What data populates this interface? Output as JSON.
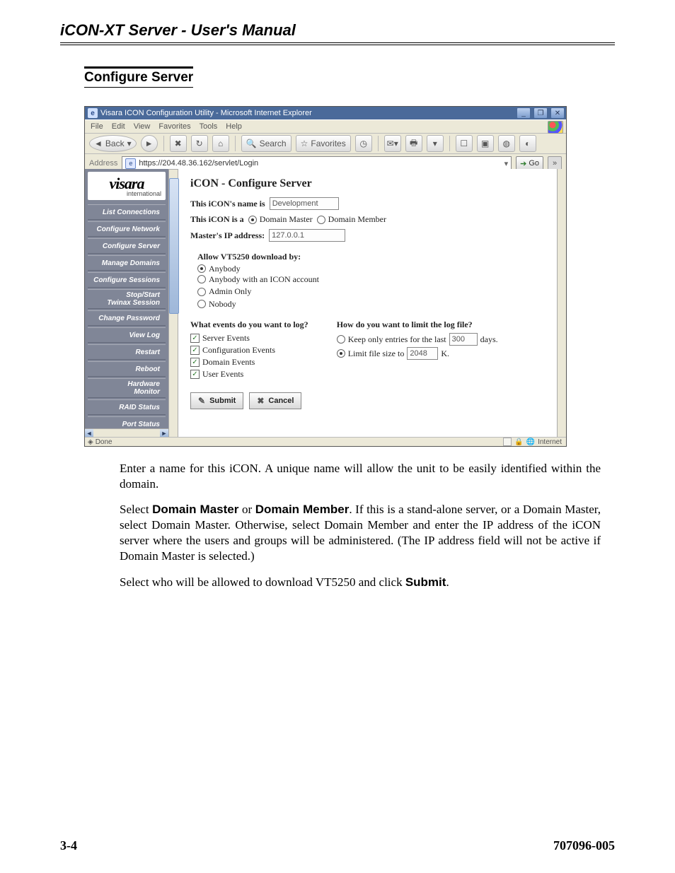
{
  "doc": {
    "header_title": "iCON-XT Server - User's Manual",
    "section_title": "Configure Server",
    "footer_left": "3-4",
    "footer_right": "707096-005"
  },
  "titlebar": {
    "app_icon": "e",
    "title": "Visara ICON Configuration Utility - Microsoft Internet Explorer",
    "min": "_",
    "restore": "❐",
    "close": "✕"
  },
  "menus": {
    "file": "File",
    "edit": "Edit",
    "view": "View",
    "favorites": "Favorites",
    "tools": "Tools",
    "help": "Help"
  },
  "toolbar": {
    "back_label": "Back",
    "search_label": "Search",
    "favorites_label": "Favorites"
  },
  "address_bar": {
    "label": "Address",
    "url": "https://204.48.36.162/servlet/Login",
    "go": "Go"
  },
  "sidebar": {
    "logo_main": "visara",
    "logo_sub": "international",
    "items": [
      "List Connections",
      "Configure Network",
      "Configure Server",
      "Manage Domains",
      "Configure Sessions",
      "Stop/Start\nTwinax Session",
      "Change Password",
      "View Log",
      "Restart",
      "Reboot",
      "Hardware\nMonitor",
      "RAID Status",
      "Port Status"
    ]
  },
  "form": {
    "heading": "iCON - Configure Server",
    "name_label": "This iCON's name is",
    "name_value": "Development",
    "role_label": "This iCON is a",
    "role_master": "Domain Master",
    "role_member": "Domain Member",
    "master_ip_label": "Master's IP address:",
    "master_ip_value": "127.0.0.1",
    "dl_head": "Allow VT5250 download by:",
    "dl_anybody": "Anybody",
    "dl_anyacct": "Anybody with an ICON account",
    "dl_admin": "Admin Only",
    "dl_nobody": "Nobody",
    "log_events_head": "What events do you want to log?",
    "ev_server": "Server Events",
    "ev_config": "Configuration Events",
    "ev_domain": "Domain Events",
    "ev_user": "User Events",
    "log_limit_head": "How do you want to limit the log file?",
    "limit_days_label_a": "Keep only entries for the last",
    "limit_days_value": "300",
    "limit_days_label_b": "days.",
    "limit_size_label_a": "Limit file size to",
    "limit_size_value": "2048",
    "limit_size_label_b": "K.",
    "submit": "Submit",
    "cancel": "Cancel"
  },
  "status": {
    "done": "Done",
    "zone": "Internet"
  },
  "bodytext": {
    "p1": "Enter a name for this iCON. A unique name will allow the unit to be easily identified within the domain.",
    "p2a": "Select ",
    "p2b": "Domain Master",
    "p2c": " or ",
    "p2d": "Domain Member",
    "p2e": ". If this is a stand-alone server, or a Domain Master, select Domain Master. Otherwise, select Domain Member and enter the IP address of the iCON server where the users and groups will be administered. (The IP address field will not be active if Domain Master is selected.)",
    "p3a": "Select who will be allowed to download VT5250 and click ",
    "p3b": "Submit",
    "p3c": "."
  }
}
